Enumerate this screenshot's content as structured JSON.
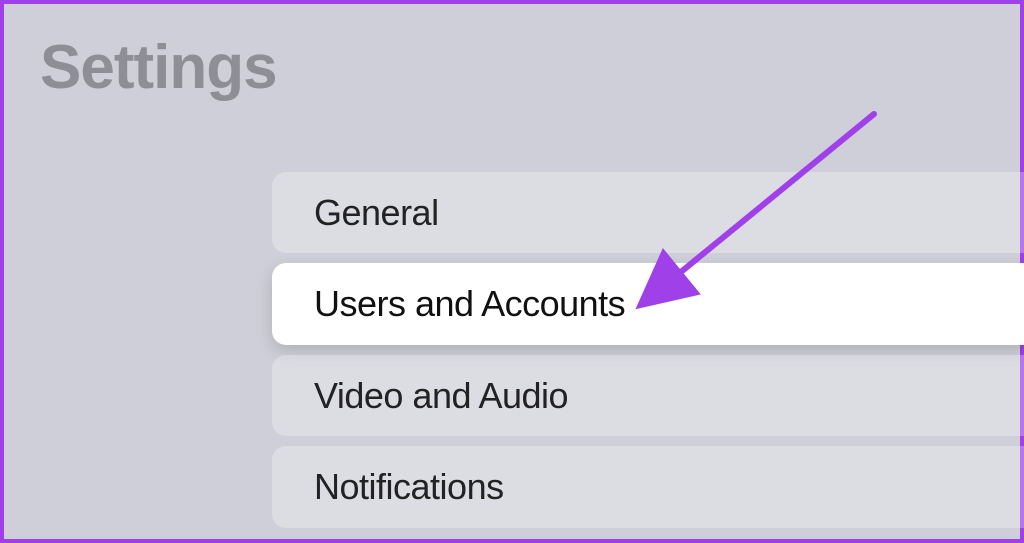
{
  "title": "Settings",
  "menu": {
    "items": [
      {
        "label": "General",
        "selected": false
      },
      {
        "label": "Users and Accounts",
        "selected": true
      },
      {
        "label": "Video and Audio",
        "selected": false
      },
      {
        "label": "Notifications",
        "selected": false
      }
    ]
  },
  "annotation": {
    "arrow_color": "#a040e8"
  }
}
